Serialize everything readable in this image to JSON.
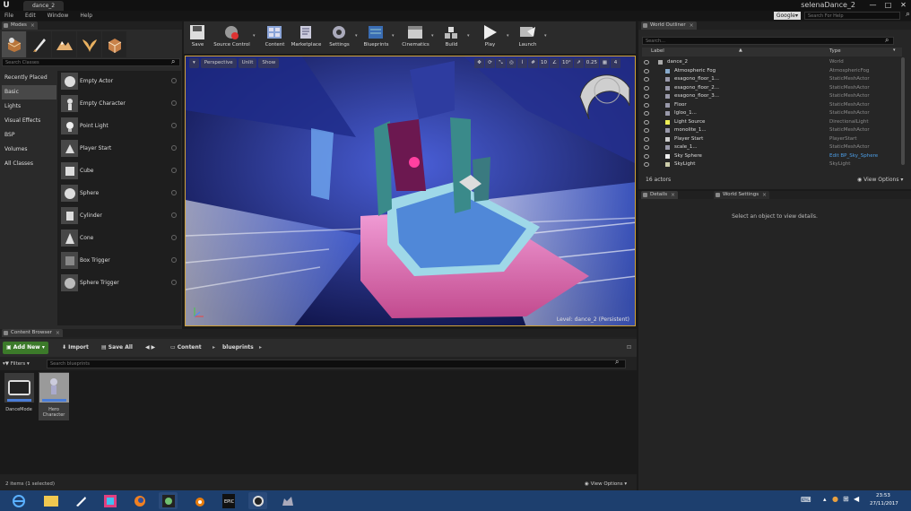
{
  "window": {
    "tab_title": "dance_2",
    "project_name": "selenaDance_2",
    "minimize": "—",
    "maximize": "□",
    "close": "✕"
  },
  "menu": [
    "File",
    "Edit",
    "Window",
    "Help"
  ],
  "help_search": {
    "provider": "Google▾",
    "placeholder": "Search For Help"
  },
  "modes": {
    "tab_label": "Modes",
    "search_placeholder": "Search Classes",
    "categories": [
      "Recently Placed",
      "Basic",
      "Lights",
      "Visual Effects",
      "BSP",
      "Volumes",
      "All Classes"
    ],
    "active_category": "Basic",
    "items": [
      "Empty Actor",
      "Empty Character",
      "Point Light",
      "Player Start",
      "Cube",
      "Sphere",
      "Cylinder",
      "Cone",
      "Box Trigger",
      "Sphere Trigger"
    ]
  },
  "toolbar": {
    "buttons": [
      "Save",
      "Source Control",
      "Content",
      "Marketplace",
      "Settings",
      "Blueprints",
      "Cinematics",
      "Build",
      "Play",
      "Launch"
    ]
  },
  "viewport": {
    "perspective": "Perspective",
    "lit": "Unlit",
    "show": "Show",
    "grid_snap": "10",
    "rot_snap": "10°",
    "scale_snap": "0.25",
    "cam_speed": "4",
    "level_label": "Level:  dance_2 (Persistent)"
  },
  "content_browser": {
    "tab_label": "Content Browser",
    "add_new": "Add New",
    "import": "Import",
    "save_all": "Save All",
    "path": [
      "Content",
      "blueprints"
    ],
    "filters": "Filters",
    "search_placeholder": "Search blueprints",
    "assets": [
      "DanceMode",
      "Hero Character"
    ],
    "items_count": "2 items (1 selected)",
    "view_options": "View Options"
  },
  "outliner": {
    "tab_label": "World Outliner",
    "search_placeholder": "Search...",
    "col_label": "Label",
    "col_type": "Type",
    "rows": [
      {
        "label": "dance_2",
        "type": "World"
      },
      {
        "label": "Atmospheric Fog",
        "type": "AtmosphericFog"
      },
      {
        "label": "esagono_floor_1...",
        "type": "StaticMeshActor"
      },
      {
        "label": "esagono_floor_2...",
        "type": "StaticMeshActor"
      },
      {
        "label": "esagono_floor_3...",
        "type": "StaticMeshActor"
      },
      {
        "label": "Floor",
        "type": "StaticMeshActor"
      },
      {
        "label": "Igloo_1...",
        "type": "StaticMeshActor"
      },
      {
        "label": "Light Source",
        "type": "DirectionalLight"
      },
      {
        "label": "monolite_1...",
        "type": "StaticMeshActor"
      },
      {
        "label": "Player Start",
        "type": "PlayerStart"
      },
      {
        "label": "scale_1...",
        "type": "StaticMeshActor"
      },
      {
        "label": "Sky Sphere",
        "type": "Edit BP_Sky_Sphere"
      },
      {
        "label": "SkyLight",
        "type": "SkyLight"
      }
    ],
    "actor_count": "16 actors",
    "view_options": "View Options"
  },
  "details": {
    "tab_label": "Details",
    "tab2_label": "World Settings",
    "empty_message": "Select an object to view details."
  },
  "taskbar": {
    "time": "23:53",
    "date": "27/11/2017"
  },
  "colors": {
    "accent_orange": "#d0a23a",
    "add_new_green": "#3c7a2a",
    "link_blue": "#4d9fe8",
    "taskbar": "#1d3f6e"
  }
}
